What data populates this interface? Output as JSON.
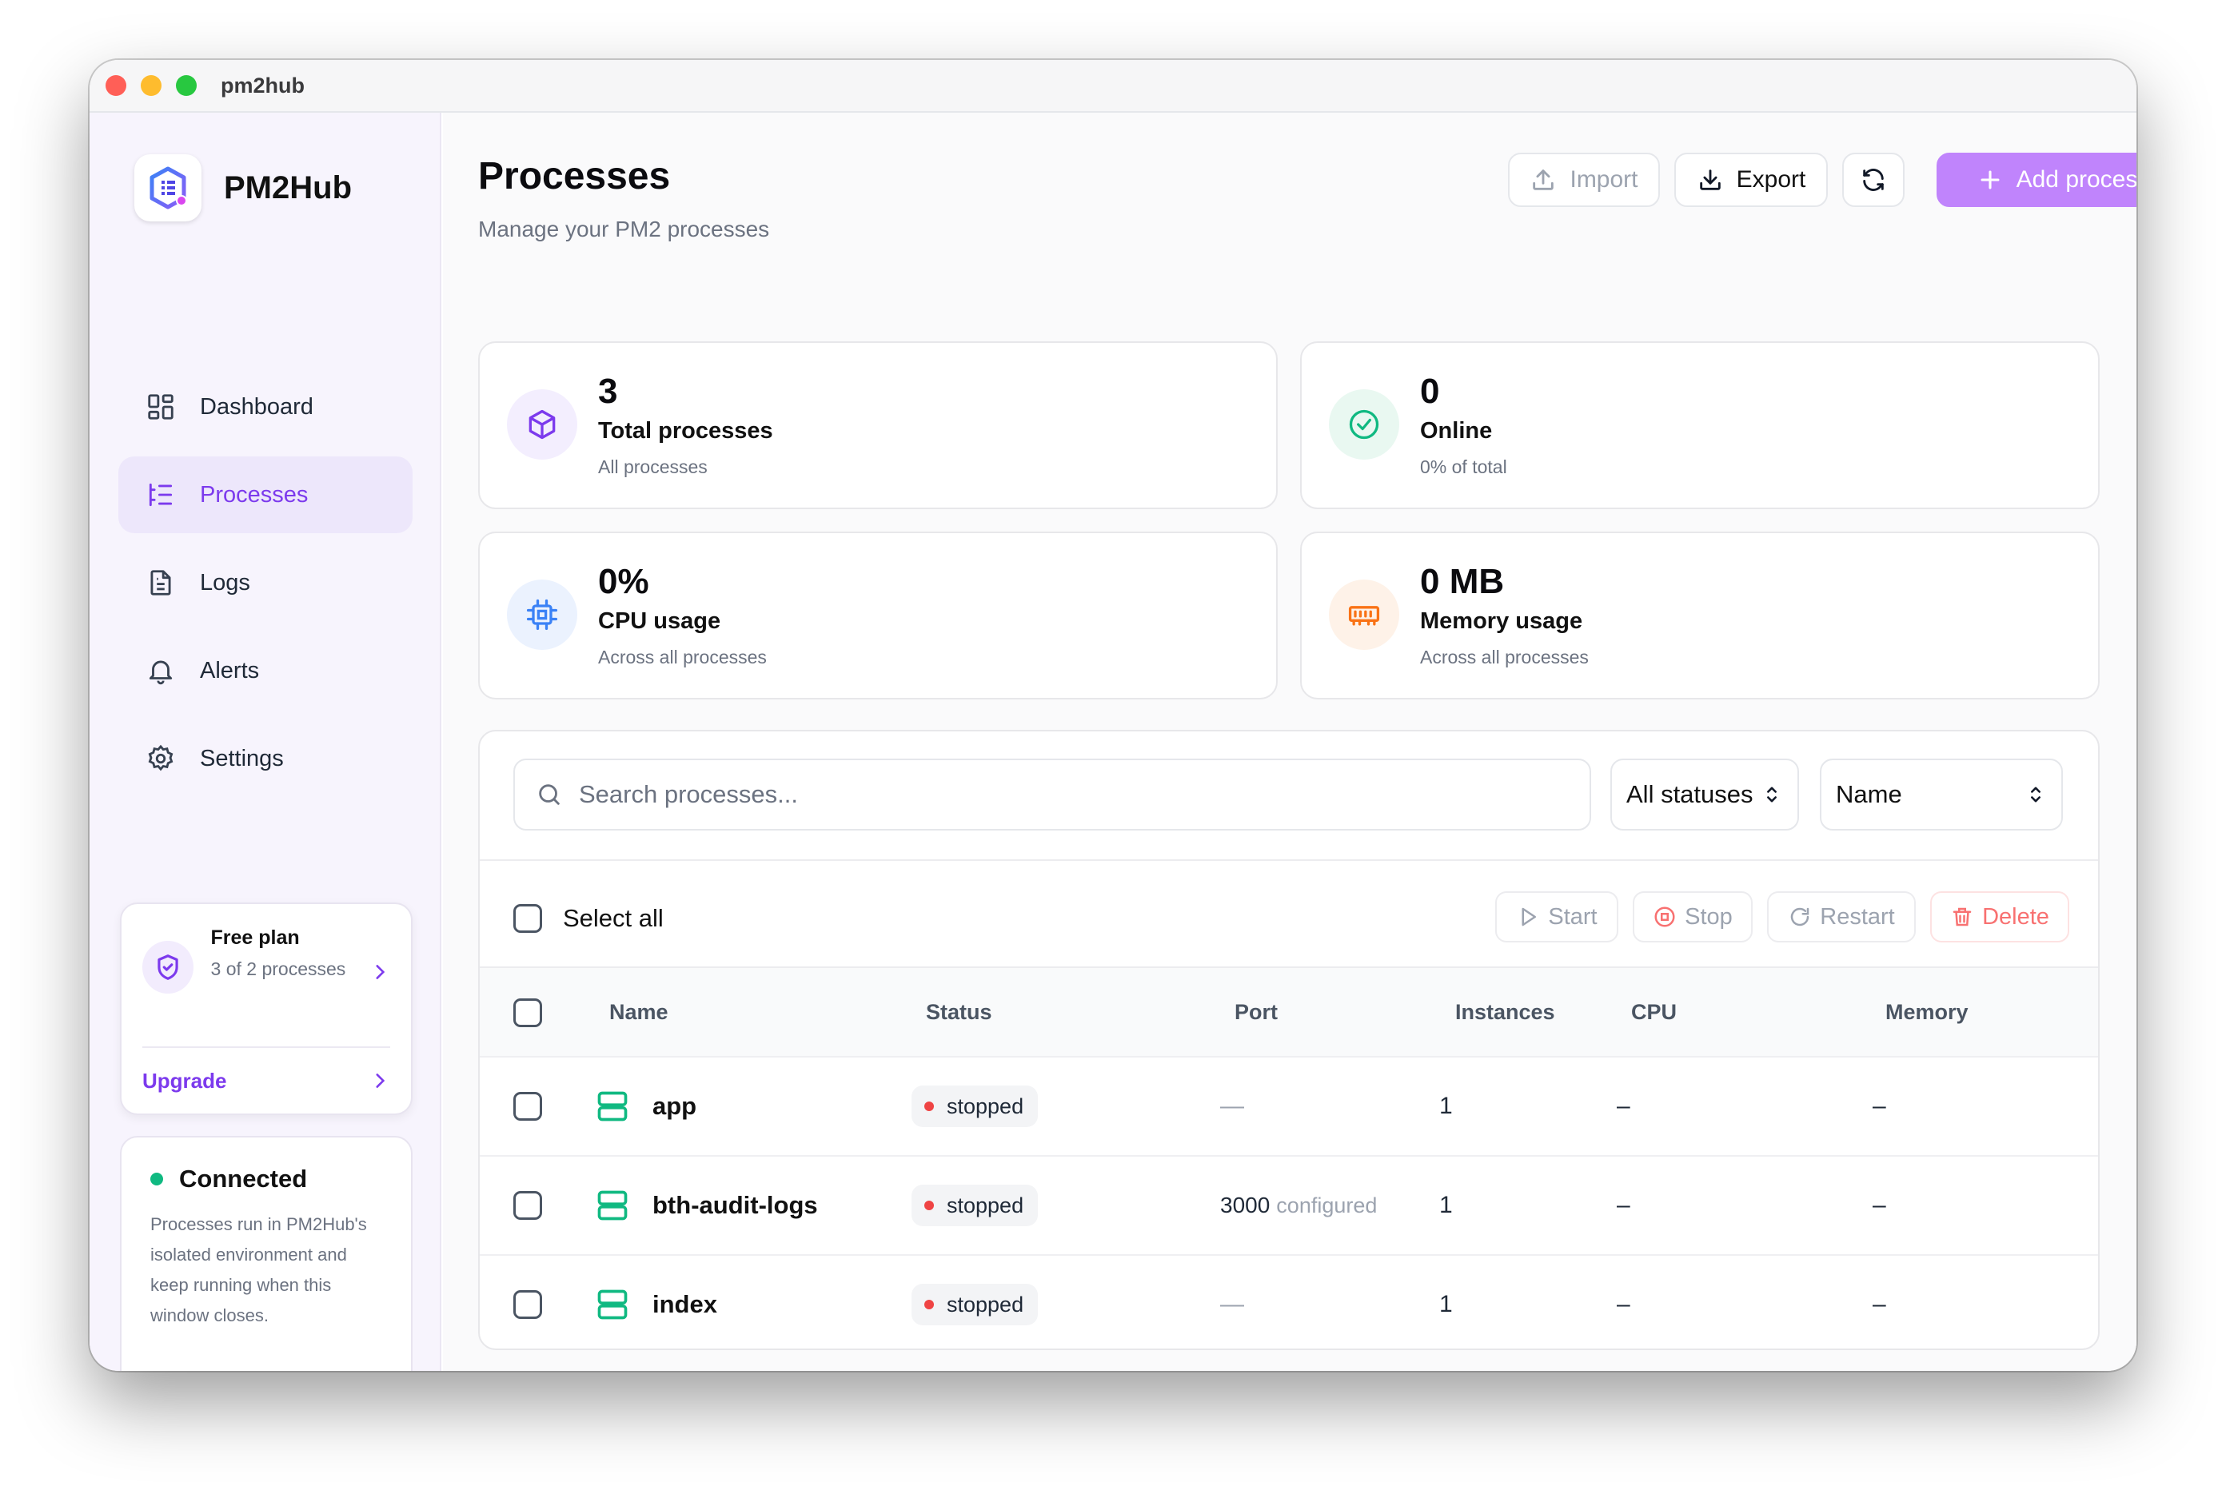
{
  "window": {
    "title": "pm2hub"
  },
  "sidebar": {
    "brand": "PM2Hub",
    "nav": [
      {
        "label": "Dashboard",
        "icon": "dashboard-icon",
        "active": false
      },
      {
        "label": "Processes",
        "icon": "list-icon",
        "active": true
      },
      {
        "label": "Logs",
        "icon": "file-icon",
        "active": false
      },
      {
        "label": "Alerts",
        "icon": "bell-icon",
        "active": false
      },
      {
        "label": "Settings",
        "icon": "gear-icon",
        "active": false
      }
    ],
    "plan": {
      "title": "Free plan",
      "usage": "3 of 2 processes",
      "upgrade_label": "Upgrade"
    },
    "connection": {
      "status": "Connected",
      "description": "Processes run in PM2Hub's isolated environment and keep running when this window closes."
    }
  },
  "header": {
    "title": "Processes",
    "subtitle": "Manage your PM2 processes",
    "import_label": "Import",
    "export_label": "Export",
    "add_label": "Add process"
  },
  "stats": [
    {
      "value": "3",
      "label": "Total processes",
      "sub": "All processes",
      "icon": "cube-icon",
      "color": "#7c3aed"
    },
    {
      "value": "0",
      "label": "Online",
      "sub": "0% of total",
      "icon": "check-circle-icon",
      "color": "#10b981"
    },
    {
      "value": "0%",
      "label": "CPU usage",
      "sub": "Across all processes",
      "icon": "cpu-icon",
      "color": "#3b82f6"
    },
    {
      "value": "0 MB",
      "label": "Memory usage",
      "sub": "Across all processes",
      "icon": "memory-icon",
      "color": "#f97316"
    }
  ],
  "filters": {
    "search_placeholder": "Search processes...",
    "status_value": "All statuses",
    "sort_value": "Name"
  },
  "actions": {
    "select_all": "Select all",
    "start": "Start",
    "stop": "Stop",
    "restart": "Restart",
    "delete": "Delete"
  },
  "table": {
    "columns": [
      "Name",
      "Status",
      "Port",
      "Instances",
      "CPU",
      "Memory"
    ],
    "rows": [
      {
        "name": "app",
        "status": "stopped",
        "port": "—",
        "port_note": "",
        "instances": "1",
        "cpu": "–",
        "memory": "–"
      },
      {
        "name": "bth-audit-logs",
        "status": "stopped",
        "port": "3000",
        "port_note": "configured",
        "instances": "1",
        "cpu": "–",
        "memory": "–"
      },
      {
        "name": "index",
        "status": "stopped",
        "port": "—",
        "port_note": "",
        "instances": "1",
        "cpu": "–",
        "memory": "–"
      }
    ]
  },
  "colors": {
    "accent": "#7c3aed",
    "add_button": "#c084fc",
    "server_icon": "#10b981",
    "stopped_dot": "#ef4444"
  }
}
